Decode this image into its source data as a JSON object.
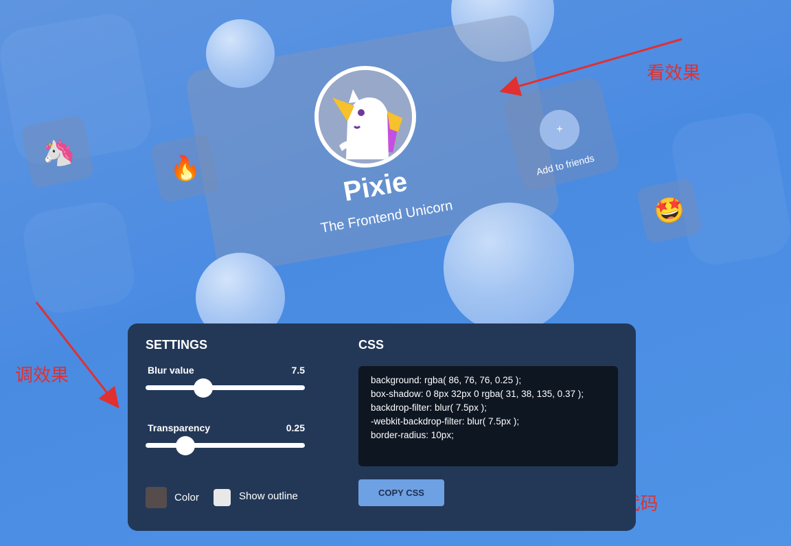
{
  "profile_card": {
    "name": "Pixie",
    "subtitle": "The Frontend Unicorn",
    "add_friends_label": "Add to friends",
    "add_icon": "+"
  },
  "floating_tiles": {
    "unicorn_emoji": "🦄",
    "fire_emoji": "🔥",
    "star_struck_emoji": "🤩"
  },
  "annotations": {
    "view_effect": "看效果",
    "adjust_effect": "调效果",
    "copy_code": "复制css代码"
  },
  "settings": {
    "title": "SETTINGS",
    "blur": {
      "label": "Blur value",
      "value": "7.5",
      "fraction": 0.36
    },
    "transparency": {
      "label": "Transparency",
      "value": "0.25",
      "fraction": 0.25
    },
    "color_label": "Color",
    "color_value": "#564c4c",
    "outline_label": "Show outline"
  },
  "css": {
    "title": "CSS",
    "lines": [
      "background: rgba( 86, 76, 76, 0.25 );",
      "box-shadow: 0 8px 32px 0 rgba( 31, 38, 135, 0.37 );",
      "backdrop-filter: blur( 7.5px );",
      "-webkit-backdrop-filter: blur( 7.5px );",
      "border-radius: 10px;"
    ],
    "copy_button": "COPY CSS"
  },
  "colors": {
    "annotation_red": "#e03030",
    "panel_bg": "#233857",
    "code_bg": "#0e1622",
    "button_bg": "#6ea0e4"
  }
}
